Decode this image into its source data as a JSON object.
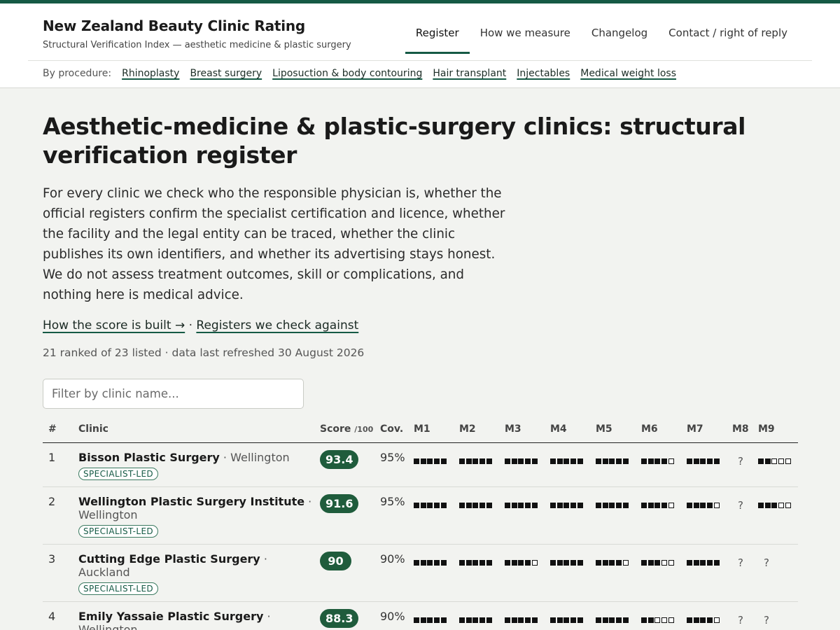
{
  "site": {
    "title": "New Zealand Beauty Clinic Rating",
    "subtitle": "Structural Verification Index — aesthetic medicine & plastic surgery"
  },
  "nav": [
    {
      "label": "Register",
      "active": true
    },
    {
      "label": "How we measure",
      "active": false
    },
    {
      "label": "Changelog",
      "active": false
    },
    {
      "label": "Contact / right of reply",
      "active": false
    }
  ],
  "procedures": {
    "label": "By procedure:",
    "items": [
      "Rhinoplasty",
      "Breast surgery",
      "Liposuction & body contouring",
      "Hair transplant",
      "Injectables",
      "Medical weight loss"
    ]
  },
  "page": {
    "heading": "Aesthetic-medicine & plastic-surgery clinics: structural verification register",
    "intro": "For every clinic we check who the responsible physician is, whether the official registers confirm the specialist certification and licence, whether the facility and the legal entity can be traced, whether the clinic publishes its own identifiers, and whether its advertising stays honest. We do not assess treatment outcomes, skill or complications, and nothing here is medical advice.",
    "link_score": "How the score is built →",
    "link_sep": " · ",
    "link_registers": "Registers we check against",
    "meta": "21 ranked of 23 listed · data last refreshed 30 August 2026",
    "filter_placeholder": "Filter by clinic name..."
  },
  "table": {
    "headers": {
      "rank": "#",
      "clinic": "Clinic",
      "score": "Score",
      "score_unit": "/100",
      "coverage": "Cov.",
      "metrics": [
        "M1",
        "M2",
        "M3",
        "M4",
        "M5",
        "M6",
        "M7",
        "M8",
        "M9"
      ]
    },
    "rows": [
      {
        "rank": "1",
        "name": "Bisson Plastic Surgery",
        "city": "Wellington",
        "badge": "SPECIALIST-LED",
        "score": "93.4",
        "coverage": "95%",
        "metrics": [
          5,
          5,
          5,
          5,
          5,
          4,
          5,
          null,
          2
        ]
      },
      {
        "rank": "2",
        "name": "Wellington Plastic Surgery Institute",
        "city": "Wellington",
        "badge": "SPECIALIST-LED",
        "score": "91.6",
        "coverage": "95%",
        "metrics": [
          5,
          5,
          5,
          5,
          5,
          4,
          4,
          null,
          3
        ]
      },
      {
        "rank": "3",
        "name": "Cutting Edge Plastic Surgery",
        "city": "Auckland",
        "badge": "SPECIALIST-LED",
        "score": "90",
        "coverage": "90%",
        "metrics": [
          5,
          5,
          4,
          5,
          4,
          3,
          5,
          null,
          null
        ]
      },
      {
        "rank": "4",
        "name": "Emily Yassaie Plastic Surgery",
        "city": "Wellington",
        "badge": "",
        "score": "88.3",
        "coverage": "90%",
        "metrics": [
          5,
          5,
          5,
          5,
          5,
          2,
          4,
          null,
          null
        ]
      }
    ],
    "unknown_symbol": "?"
  }
}
